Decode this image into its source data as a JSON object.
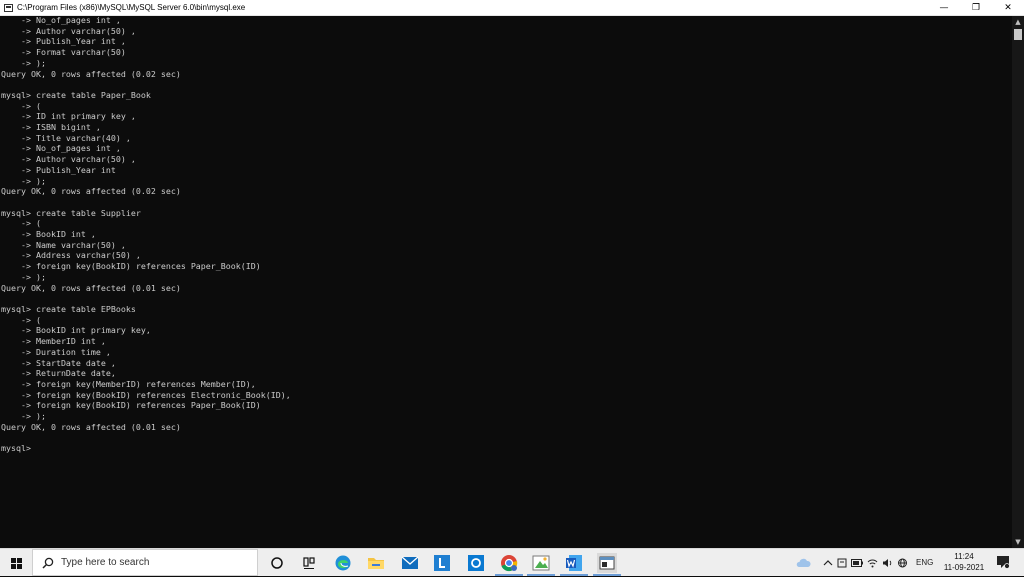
{
  "window": {
    "title": "C:\\Program Files (x86)\\MySQL\\MySQL Server 6.0\\bin\\mysql.exe",
    "minimize_glyph": "—",
    "restore_glyph": "❐",
    "close_glyph": "✕"
  },
  "console": {
    "lines": [
      "    -> No_of_pages int ,",
      "    -> Author varchar(50) ,",
      "    -> Publish_Year int ,",
      "    -> Format varchar(50)",
      "    -> );",
      "Query OK, 0 rows affected (0.02 sec)",
      "",
      "mysql> create table Paper_Book",
      "    -> (",
      "    -> ID int primary key ,",
      "    -> ISBN bigint ,",
      "    -> Title varchar(40) ,",
      "    -> No_of_pages int ,",
      "    -> Author varchar(50) ,",
      "    -> Publish_Year int",
      "    -> );",
      "Query OK, 0 rows affected (0.02 sec)",
      "",
      "mysql> create table Supplier",
      "    -> (",
      "    -> BookID int ,",
      "    -> Name varchar(50) ,",
      "    -> Address varchar(50) ,",
      "    -> foreign key(BookID) references Paper_Book(ID)",
      "    -> );",
      "Query OK, 0 rows affected (0.01 sec)",
      "",
      "mysql> create table EPBooks",
      "    -> (",
      "    -> BookID int primary key,",
      "    -> MemberID int ,",
      "    -> Duration time ,",
      "    -> StartDate date ,",
      "    -> ReturnDate date,",
      "    -> foreign key(MemberID) references Member(ID),",
      "    -> foreign key(BookID) references Electronic_Book(ID),",
      "    -> foreign key(BookID) references Paper_Book(ID)",
      "    -> );",
      "Query OK, 0 rows affected (0.01 sec)",
      "",
      "mysql> "
    ]
  },
  "taskbar": {
    "search_placeholder": "Type here to search",
    "pinned": [
      "cortana-icon",
      "task-view-icon",
      "edge-icon",
      "file-explorer-icon",
      "mail-icon",
      "l-app-icon",
      "outlook-app-icon",
      "chrome-icon",
      "paint-icon",
      "word-icon",
      "console-icon"
    ],
    "language": "ENG",
    "time": "11:24",
    "date": "11-09-2021"
  },
  "colors": {
    "console_bg": "#0c0c0c",
    "console_text": "#cccccc",
    "taskbar_bg": "#eeeeee",
    "accent": "#6b9cd6"
  }
}
